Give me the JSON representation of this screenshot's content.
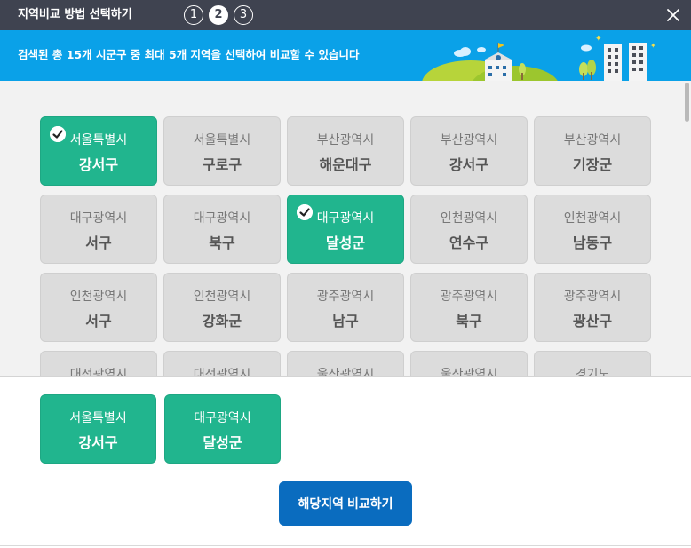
{
  "window": {
    "title": "지역비교 방법 선택하기",
    "steps": [
      "1",
      "2",
      "3"
    ],
    "active_step": 2
  },
  "banner": {
    "text": "검색된 총 15개 시군구 중 최대 5개 지역을 선택하여 비교할 수 있습니다"
  },
  "regions": [
    {
      "city": "서울특별시",
      "district": "강서구",
      "selected": true
    },
    {
      "city": "서울특별시",
      "district": "구로구",
      "selected": false
    },
    {
      "city": "부산광역시",
      "district": "해운대구",
      "selected": false
    },
    {
      "city": "부산광역시",
      "district": "강서구",
      "selected": false
    },
    {
      "city": "부산광역시",
      "district": "기장군",
      "selected": false
    },
    {
      "city": "대구광역시",
      "district": "서구",
      "selected": false
    },
    {
      "city": "대구광역시",
      "district": "북구",
      "selected": false
    },
    {
      "city": "대구광역시",
      "district": "달성군",
      "selected": true
    },
    {
      "city": "인천광역시",
      "district": "연수구",
      "selected": false
    },
    {
      "city": "인천광역시",
      "district": "남동구",
      "selected": false
    },
    {
      "city": "인천광역시",
      "district": "서구",
      "selected": false
    },
    {
      "city": "인천광역시",
      "district": "강화군",
      "selected": false
    },
    {
      "city": "광주광역시",
      "district": "남구",
      "selected": false
    },
    {
      "city": "광주광역시",
      "district": "북구",
      "selected": false
    },
    {
      "city": "광주광역시",
      "district": "광산구",
      "selected": false
    },
    {
      "city": "대전광역시",
      "district": "",
      "selected": false
    },
    {
      "city": "대전광역시",
      "district": "",
      "selected": false
    },
    {
      "city": "울산광역시",
      "district": "",
      "selected": false
    },
    {
      "city": "울산광역시",
      "district": "",
      "selected": false
    },
    {
      "city": "경기도",
      "district": "",
      "selected": false
    }
  ],
  "selected_regions": [
    {
      "city": "서울특별시",
      "district": "강서구"
    },
    {
      "city": "대구광역시",
      "district": "달성군"
    }
  ],
  "compare_button": "해당지역 비교하기",
  "colors": {
    "titlebar": "#3f4350",
    "banner": "#0aa1e8",
    "selected": "#21b58e",
    "primary_button": "#0a6cbf"
  }
}
